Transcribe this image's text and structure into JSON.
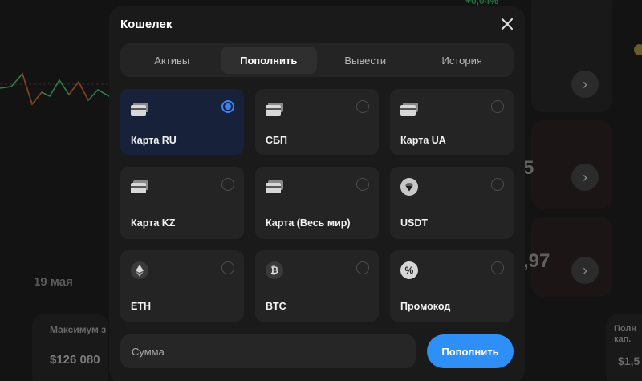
{
  "background": {
    "percent_change": "+0,04%",
    "date_label": "19 мая",
    "max_label": "Максимум з",
    "max_value": "$126 080",
    "right_label": "Полн кап.",
    "right_value": "$1,5",
    "big_value_1": "5",
    "big_value_2": ",97"
  },
  "modal": {
    "title": "Кошелек",
    "tabs": [
      {
        "label": "Активы",
        "active": false
      },
      {
        "label": "Пополнить",
        "active": true
      },
      {
        "label": "Вывести",
        "active": false
      },
      {
        "label": "История",
        "active": false
      }
    ],
    "methods": [
      {
        "label": "Карта RU",
        "icon": "card-icon",
        "selected": true
      },
      {
        "label": "СБП",
        "icon": "card-icon",
        "selected": false
      },
      {
        "label": "Карта UA",
        "icon": "card-icon",
        "selected": false
      },
      {
        "label": "Карта KZ",
        "icon": "card-icon",
        "selected": false
      },
      {
        "label": "Карта (Весь мир)",
        "icon": "card-icon",
        "selected": false
      },
      {
        "label": "USDT",
        "icon": "diamond-icon",
        "selected": false
      },
      {
        "label": "ETH",
        "icon": "ethereum-icon",
        "selected": false
      },
      {
        "label": "BTC",
        "icon": "bitcoin-icon",
        "selected": false
      },
      {
        "label": "Промокод",
        "icon": "percent-icon",
        "selected": false
      }
    ],
    "amount_placeholder": "Сумма",
    "submit_label": "Пополнить"
  },
  "colors": {
    "accent": "#2e8ff6",
    "selected_card": "#17223a",
    "card": "#242424",
    "modal": "#1a1a1a"
  }
}
